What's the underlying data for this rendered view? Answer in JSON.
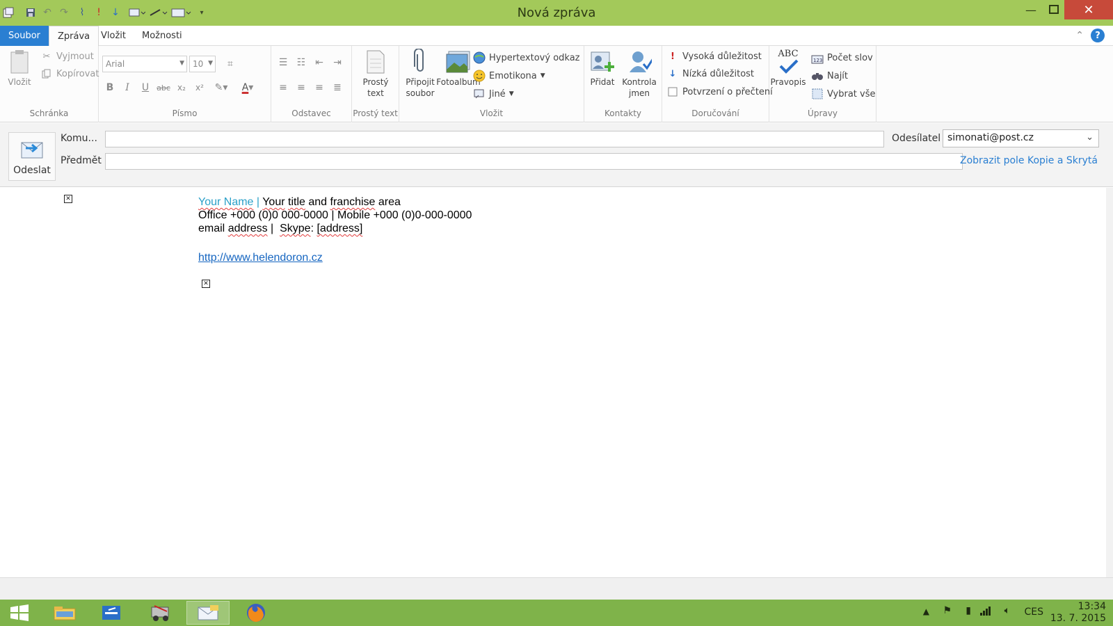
{
  "window": {
    "title": "Nová zpráva"
  },
  "tabs": [
    "Soubor",
    "Zpráva",
    "Vložit",
    "Možnosti"
  ],
  "ribbon": {
    "clipboard": {
      "label": "Schránka",
      "paste": "Vložit",
      "cut": "Vyjmout",
      "copy": "Kopírovat"
    },
    "font": {
      "label": "Písmo",
      "family": "Arial",
      "size": "10"
    },
    "paragraph": {
      "label": "Odstavec"
    },
    "plain": {
      "label": "Prostý text",
      "button_line1": "Prostý",
      "button_line2": "text"
    },
    "insert": {
      "label": "Vložit",
      "attach_line1": "Připojit",
      "attach_line2": "soubor",
      "photoalbum": "Fotoalbum",
      "hyperlink": "Hypertextový odkaz",
      "emoticon": "Emotikona",
      "other": "Jiné"
    },
    "contacts": {
      "label": "Kontakty",
      "add": "Přidat",
      "check_line1": "Kontrola",
      "check_line2": "jmen"
    },
    "delivery": {
      "label": "Doručování",
      "high": "Vysoká důležitost",
      "low": "Nízká důležitost",
      "receipt": "Potvrzení o přečtení"
    },
    "editing": {
      "label": "Úpravy",
      "abc": "ABC",
      "spelling": "Pravopis",
      "word_count": "Počet slov",
      "find": "Najít",
      "select_all": "Vybrat vše"
    }
  },
  "compose": {
    "send": "Odeslat",
    "to_label": "Komu...",
    "subject_label": "Předmět",
    "to_value": "",
    "subject_value": "",
    "sender_label": "Odesílatel",
    "sender_value": "simonati@post.cz",
    "cc_link": "Zobrazit pole Kopie a Skrytá"
  },
  "signature": {
    "name": "Your Name",
    "sep": " | ",
    "title_a": "Your",
    "title_b": "title",
    "title_c": "and",
    "title_d": "franchise",
    "title_e": "area",
    "line2": "Office +000 (0)0 000-0000 | Mobile +000 (0)0-000-0000",
    "email_a": "email",
    "email_b": "address",
    "email_sep": " |  ",
    "skype_a": "Skype",
    "skype_b": ": ",
    "skype_c": "[address]",
    "url": "http://www.helendoron.cz"
  },
  "taskbar": {
    "lang": "CES",
    "time": "13:34",
    "date": "13. 7. 2015"
  },
  "colors": {
    "titlebar": "#a3c95a",
    "accent": "#2a7fd2",
    "close": "#c74a3a",
    "taskbar": "#7fb34a"
  }
}
